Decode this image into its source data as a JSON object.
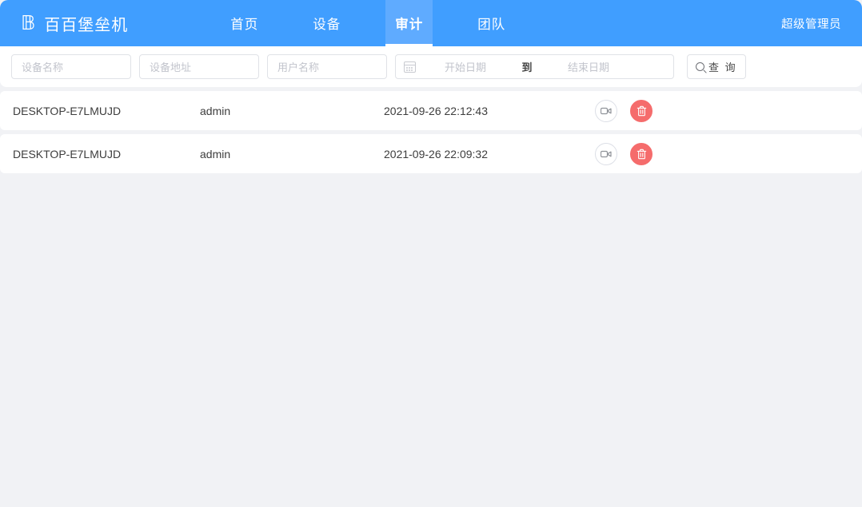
{
  "header": {
    "logo_icon": "double-struck-b-logo",
    "title": "百百堡垒机",
    "nav": [
      {
        "label": "首页",
        "active": false
      },
      {
        "label": "设备",
        "active": false
      },
      {
        "label": "审计",
        "active": true
      },
      {
        "label": "团队",
        "active": false
      }
    ],
    "user_label": "超级管理员",
    "background_color": "#409eff",
    "active_tab_color": "#5fabff"
  },
  "search": {
    "device_name_placeholder": "设备名称",
    "device_address_placeholder": "设备地址",
    "user_name_placeholder": "用户名称",
    "calendar_icon": "calendar-icon",
    "start_date_placeholder": "开始日期",
    "date_separator": "到",
    "end_date_placeholder": "结束日期",
    "query_icon": "search-icon",
    "query_label": "查 询"
  },
  "table": {
    "rows": [
      {
        "device_name": "DESKTOP-E7LMUJD",
        "user_name": "admin",
        "timestamp": "2021-09-26 22:12:43",
        "play_icon": "video-camera-icon",
        "delete_icon": "trash-icon"
      },
      {
        "device_name": "DESKTOP-E7LMUJD",
        "user_name": "admin",
        "timestamp": "2021-09-26 22:09:32",
        "play_icon": "video-camera-icon",
        "delete_icon": "trash-icon"
      }
    ],
    "delete_button_color": "#f56c6c"
  },
  "page": {
    "background_color": "#f1f2f5"
  }
}
